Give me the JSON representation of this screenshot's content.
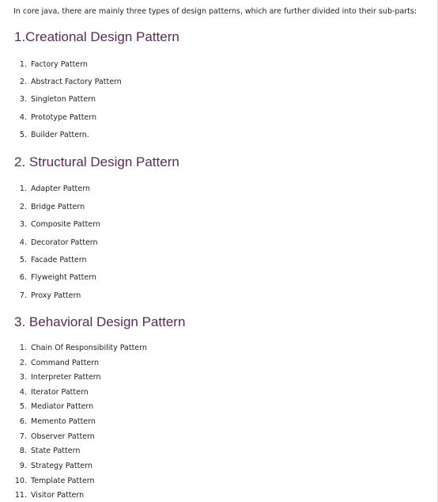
{
  "intro": "In core java, there are mainly three types of design patterns, which are further divided into their sub-parts:",
  "sections": [
    {
      "heading": "1.Creational Design Pattern",
      "items": [
        {
          "num": "1.",
          "label": "Factory Pattern"
        },
        {
          "num": "2.",
          "label": "Abstract Factory Pattern"
        },
        {
          "num": "3.",
          "label": "Singleton Pattern"
        },
        {
          "num": "4.",
          "label": "Prototype Pattern"
        },
        {
          "num": "5.",
          "label": "Builder Pattern."
        }
      ]
    },
    {
      "heading": "2. Structural Design Pattern",
      "items": [
        {
          "num": "1.",
          "label": "Adapter Pattern"
        },
        {
          "num": "2.",
          "label": "Bridge Pattern"
        },
        {
          "num": "3.",
          "label": "Composite Pattern"
        },
        {
          "num": "4.",
          "label": "Decorator Pattern"
        },
        {
          "num": "5.",
          "label": "Facade Pattern"
        },
        {
          "num": "6.",
          "label": "Flyweight Pattern"
        },
        {
          "num": "7.",
          "label": "Proxy Pattern"
        }
      ]
    },
    {
      "heading": "3. Behavioral Design Pattern",
      "items": [
        {
          "num": "1.",
          "label": "Chain Of Responsibility Pattern"
        },
        {
          "num": "2.",
          "label": "Command Pattern"
        },
        {
          "num": "3.",
          "label": "Interpreter Pattern"
        },
        {
          "num": "4.",
          "label": "Iterator Pattern"
        },
        {
          "num": "5.",
          "label": "Mediator Pattern"
        },
        {
          "num": "6.",
          "label": "Memento Pattern"
        },
        {
          "num": "7.",
          "label": "Observer Pattern"
        },
        {
          "num": "8.",
          "label": "State Pattern"
        },
        {
          "num": "9.",
          "label": "Strategy Pattern"
        },
        {
          "num": "10.",
          "label": "Template Pattern"
        },
        {
          "num": "11.",
          "label": "Visitor Pattern"
        }
      ]
    }
  ],
  "colors": {
    "heading": "#5b2a55",
    "text": "#222222"
  }
}
